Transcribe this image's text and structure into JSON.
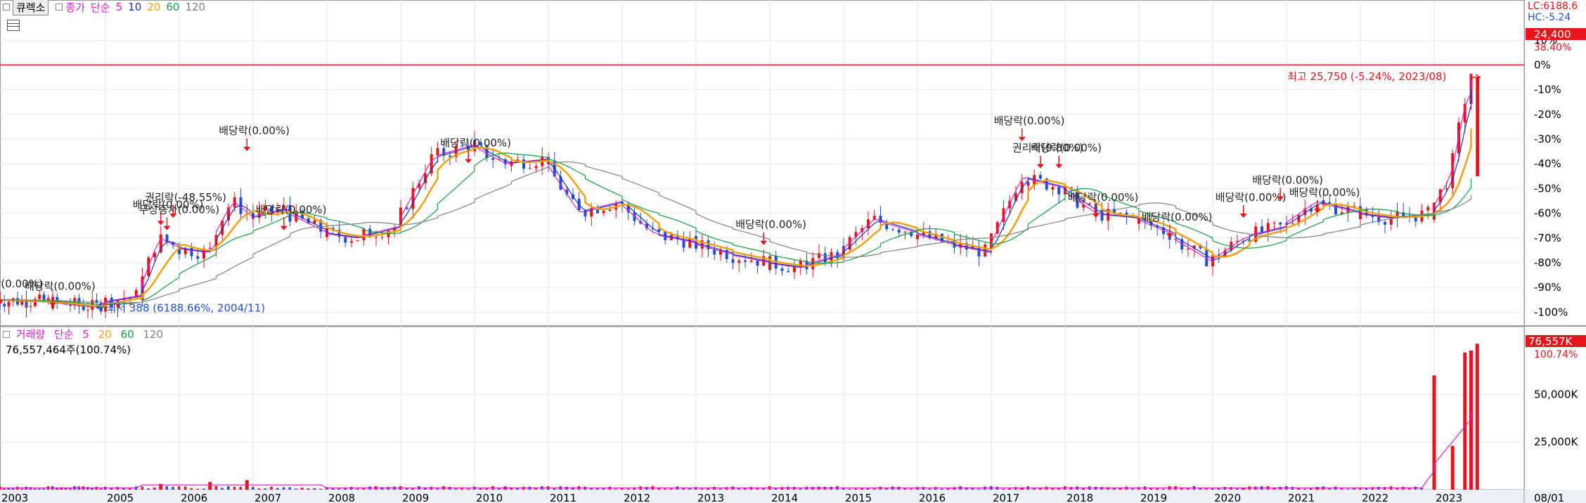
{
  "header": {
    "exchange_tag": "큐렉소",
    "price_label": "종가",
    "ma_label": "단순",
    "ma_periods": [
      "5",
      "10",
      "20",
      "60",
      "120"
    ]
  },
  "volume_header": {
    "label": "거래량",
    "ma_label": "단순",
    "ma_periods": [
      "5",
      "20",
      "60",
      "120"
    ],
    "current": "76,557,464주(100.74%)"
  },
  "right_readout": {
    "lc": "LC:6188.6",
    "hc": "HC:-5.24",
    "last_price": "24,400",
    "last_pct": "38.40%",
    "last_volume": "76,557K",
    "last_volume_pct": "100.74%"
  },
  "colors": {
    "up": "#e8141b",
    "down": "#1f4fd6",
    "ma5": "#e020c8",
    "ma10": "#2030c0",
    "ma20": "#f0a010",
    "ma60": "#10a040",
    "ma120": "#808080",
    "refline": "#e02020"
  },
  "chart_data": [
    {
      "type": "candlestick",
      "title": "큐렉소 종가",
      "y_axis": "percent",
      "ylim": [
        -105,
        20
      ],
      "y_ticks": [
        "10%",
        "0%",
        "-10%",
        "-20%",
        "-30%",
        "-40%",
        "-50%",
        "-60%",
        "-70%",
        "-80%",
        "-90%",
        "-100%"
      ],
      "x_ticks": [
        "2003",
        "2005",
        "2006",
        "2007",
        "2008",
        "2009",
        "2010",
        "2011",
        "2012",
        "2013",
        "2014",
        "2015",
        "2016",
        "2017",
        "2018",
        "2019",
        "2020",
        "2021",
        "2022",
        "2023",
        "08/01"
      ],
      "moving_averages": [
        "5",
        "10",
        "20",
        "60",
        "120"
      ],
      "series_close_pct": [
        {
          "x": "2003",
          "y": -95
        },
        {
          "x": "2004",
          "y": -96
        },
        {
          "x": "2004/11",
          "y": -98
        },
        {
          "x": "2005",
          "y": -96
        },
        {
          "x": "2005/07",
          "y": -93
        },
        {
          "x": "2005/10",
          "y": -70
        },
        {
          "x": "2006",
          "y": -74
        },
        {
          "x": "2006/06",
          "y": -76
        },
        {
          "x": "2006/10",
          "y": -55
        },
        {
          "x": "2007",
          "y": -62
        },
        {
          "x": "2007/06",
          "y": -58
        },
        {
          "x": "2008",
          "y": -68
        },
        {
          "x": "2008/06",
          "y": -70
        },
        {
          "x": "2009",
          "y": -65
        },
        {
          "x": "2009/06",
          "y": -38
        },
        {
          "x": "2010",
          "y": -32
        },
        {
          "x": "2010/06",
          "y": -40
        },
        {
          "x": "2011",
          "y": -38
        },
        {
          "x": "2011/06",
          "y": -60
        },
        {
          "x": "2012",
          "y": -55
        },
        {
          "x": "2012/06",
          "y": -68
        },
        {
          "x": "2013",
          "y": -72
        },
        {
          "x": "2013/06",
          "y": -76
        },
        {
          "x": "2014",
          "y": -80
        },
        {
          "x": "2014/06",
          "y": -82
        },
        {
          "x": "2015",
          "y": -76
        },
        {
          "x": "2015/06",
          "y": -62
        },
        {
          "x": "2016",
          "y": -68
        },
        {
          "x": "2016/06",
          "y": -72
        },
        {
          "x": "2017",
          "y": -76
        },
        {
          "x": "2017/06",
          "y": -45
        },
        {
          "x": "2018",
          "y": -50
        },
        {
          "x": "2018/06",
          "y": -60
        },
        {
          "x": "2019",
          "y": -62
        },
        {
          "x": "2019/06",
          "y": -68
        },
        {
          "x": "2020",
          "y": -80
        },
        {
          "x": "2020/06",
          "y": -70
        },
        {
          "x": "2021",
          "y": -65
        },
        {
          "x": "2021/06",
          "y": -55
        },
        {
          "x": "2022",
          "y": -60
        },
        {
          "x": "2022/06",
          "y": -62
        },
        {
          "x": "2023",
          "y": -60
        },
        {
          "x": "2023/04",
          "y": -45
        },
        {
          "x": "2023/06",
          "y": -15
        },
        {
          "x": "2023/08",
          "y": -5
        }
      ],
      "reference_line_pct": 0,
      "annotations": [
        {
          "text": "최고 25,750 (-5.24%, 2023/08)",
          "x": "2023/08",
          "y": -5
        },
        {
          "text": "최저 388 (6188.66%, 2004/11)",
          "x": "2004/11",
          "y": -98
        },
        {
          "text": "배당락(0.00%)",
          "x": "2003",
          "y": -90
        },
        {
          "text": "배당락(0.00%)",
          "x": "2004",
          "y": -91
        },
        {
          "text": "배당락(0.00%)",
          "x": "2005/10",
          "y": -58
        },
        {
          "text": "무상증자(0.00%)",
          "x": "2005/11",
          "y": -60
        },
        {
          "text": "권리락(-48.55%)",
          "x": "2005/12",
          "y": -55
        },
        {
          "text": "배당락(0.00%)",
          "x": "2006/12",
          "y": -28
        },
        {
          "text": "배당락(0.00%)",
          "x": "2007/06",
          "y": -60
        },
        {
          "text": "배당락(0.00%)",
          "x": "2009/12",
          "y": -33
        },
        {
          "text": "배당락(0.00%)",
          "x": "2013/12",
          "y": -66
        },
        {
          "text": "배당락(0.00%)",
          "x": "2017/06",
          "y": -24
        },
        {
          "text": "권리락(9.80%)",
          "x": "2017/09",
          "y": -35
        },
        {
          "text": "배당락(0.00%)",
          "x": "2017/12",
          "y": -35
        },
        {
          "text": "배당락(0.00%)",
          "x": "2018/06",
          "y": -55
        },
        {
          "text": "배당락(0.00%)",
          "x": "2019/06",
          "y": -63
        },
        {
          "text": "배당락(0.00%)",
          "x": "2020/06",
          "y": -55
        },
        {
          "text": "배당락(0.00%)",
          "x": "2020/12",
          "y": -48
        },
        {
          "text": "배당락(0.00%)",
          "x": "2021/06",
          "y": -53
        }
      ]
    },
    {
      "type": "bar",
      "title": "거래량",
      "y_ticks": [
        "50,000K",
        "25,000K"
      ],
      "ylim": [
        0,
        80000
      ],
      "values_k": [
        {
          "x": "2005/10",
          "y": 3000
        },
        {
          "x": "2006/06",
          "y": 4000
        },
        {
          "x": "2006/12",
          "y": 5000
        },
        {
          "x": "2010/06",
          "y": 1500
        },
        {
          "x": "2017/06",
          "y": 1200
        },
        {
          "x": "2020/06",
          "y": 1000
        },
        {
          "x": "2021/06",
          "y": 1400
        },
        {
          "x": "2023/01",
          "y": 60000
        },
        {
          "x": "2023/04",
          "y": 23000
        },
        {
          "x": "2023/06",
          "y": 72000
        },
        {
          "x": "2023/07",
          "y": 73000
        },
        {
          "x": "2023/08",
          "y": 76557
        }
      ]
    }
  ]
}
